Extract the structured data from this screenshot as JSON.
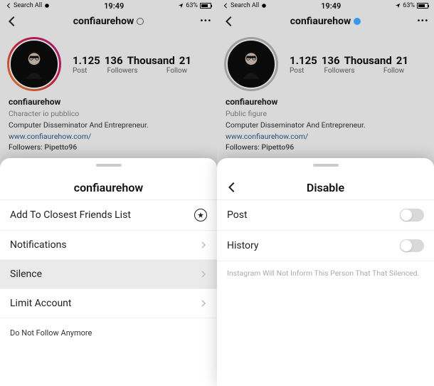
{
  "status": {
    "searchLabel": "Search All",
    "time": "19:49",
    "batteryPct": "63%"
  },
  "profile": {
    "usernameTitleLeft": "confiaurehow",
    "usernameTitleRight": "confiaurehow",
    "stats": {
      "posts": "1.125",
      "followers": "136",
      "followersWord": "Thousand",
      "following": "21",
      "postsLabel": "Post",
      "followersLabel": "Followers",
      "followLabel": "Follow"
    },
    "bioName": "confiaurehow",
    "categoryLeft": "Character",
    "categoryLeftSuffix": "io pubblico",
    "categoryRight": "Public figure",
    "tagline": "Computer Disseminator And Entrepreneur.",
    "website": "www.confiaurehow.com/",
    "followedByLabel": "Followers:",
    "followedBy": "Pipetto96"
  },
  "sheetLeft": {
    "title": "confiaurehow",
    "rowAdd": "Add To Closest Friends List",
    "rowNotifications": "Notifications",
    "rowSilence": "Silence",
    "rowLimit": "Limit Account",
    "rowUnfollow": "Do Not Follow Anymore"
  },
  "sheetRight": {
    "title": "Disable",
    "rowPost": "Post",
    "rowHistory": "History",
    "note": "Instagram Will Not Inform This Person That That Silenced."
  }
}
